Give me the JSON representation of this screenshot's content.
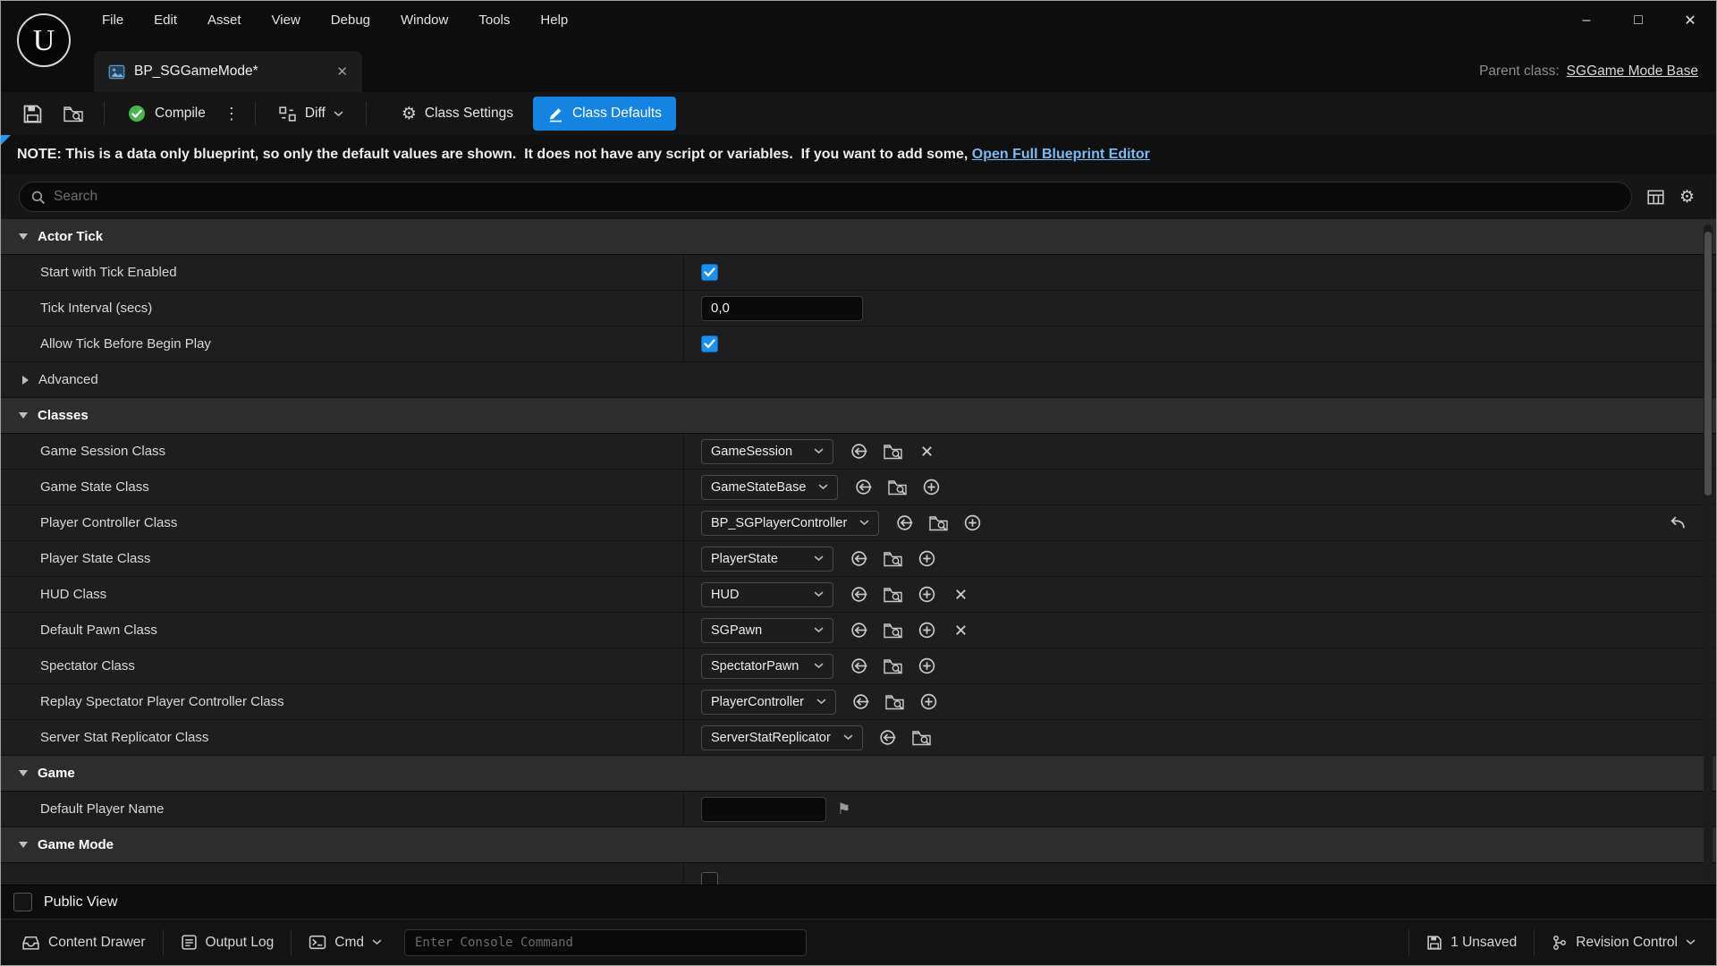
{
  "colors": {
    "accent": "#1583e0",
    "checkbox_blue": "#1f8fef",
    "link_blue": "#7cb9f7",
    "compile_green": "#46b54e"
  },
  "icons": {
    "gear": "⚙",
    "kebab": "⋮",
    "flag": "⚑"
  },
  "menu": {
    "items": [
      "File",
      "Edit",
      "Asset",
      "View",
      "Debug",
      "Window",
      "Tools",
      "Help"
    ]
  },
  "window_controls": {
    "minimize": "–",
    "maximize": "□",
    "close": "✕"
  },
  "tab": {
    "title": "BP_SGGameMode*",
    "close": "✕"
  },
  "parent_class": {
    "label": "Parent class:",
    "value": "SGGame Mode Base"
  },
  "toolbar": {
    "compile": "Compile",
    "diff": "Diff",
    "class_settings": "Class Settings",
    "class_defaults": "Class Defaults"
  },
  "note": {
    "prefix": "NOTE: This is a data only blueprint, so only the default values are shown.  It does not have any script or variables.  If you want to add some, ",
    "link": "Open Full Blueprint Editor"
  },
  "search": {
    "placeholder": "Search"
  },
  "details": {
    "sections": [
      {
        "title": "Actor Tick",
        "rows": [
          {
            "label": "Start with Tick Enabled",
            "type": "checkbox",
            "checked": true
          },
          {
            "label": "Tick Interval (secs)",
            "type": "text",
            "value": "0,0"
          },
          {
            "label": "Allow Tick Before Begin Play",
            "type": "checkbox",
            "checked": true
          },
          {
            "label": "Advanced",
            "type": "category-collapsed"
          }
        ]
      },
      {
        "title": "Classes",
        "rows": [
          {
            "label": "Game Session Class",
            "type": "class",
            "value": "GameSession",
            "icons": [
              "use-selected-icon",
              "browse-icon",
              "clear-icon"
            ]
          },
          {
            "label": "Game State Class",
            "type": "class",
            "value": "GameStateBase",
            "icons": [
              "use-selected-icon",
              "browse-icon",
              "plus-icon"
            ]
          },
          {
            "label": "Player Controller Class",
            "type": "class",
            "value": "BP_SGPlayerController",
            "icons": [
              "use-selected-icon",
              "browse-icon",
              "plus-icon"
            ],
            "revert": true
          },
          {
            "label": "Player State Class",
            "type": "class",
            "value": "PlayerState",
            "icons": [
              "use-selected-icon",
              "browse-icon",
              "plus-icon"
            ]
          },
          {
            "label": "HUD Class",
            "type": "class",
            "value": "HUD",
            "icons": [
              "use-selected-icon",
              "browse-icon",
              "plus-icon",
              "clear-icon"
            ]
          },
          {
            "label": "Default Pawn Class",
            "type": "class",
            "value": "SGPawn",
            "icons": [
              "use-selected-icon",
              "browse-icon",
              "plus-icon",
              "clear-icon"
            ]
          },
          {
            "label": "Spectator Class",
            "type": "class",
            "value": "SpectatorPawn",
            "icons": [
              "use-selected-icon",
              "browse-icon",
              "plus-icon"
            ]
          },
          {
            "label": "Replay Spectator Player Controller Class",
            "type": "class",
            "value": "PlayerController",
            "icons": [
              "use-selected-icon",
              "browse-icon",
              "plus-icon"
            ]
          },
          {
            "label": "Server Stat Replicator Class",
            "type": "class",
            "value": "ServerStatReplicator",
            "icons": [
              "use-selected-icon",
              "browse-icon"
            ]
          }
        ]
      },
      {
        "title": "Game",
        "rows": [
          {
            "label": "Default Player Name",
            "type": "text-flag",
            "value": ""
          }
        ]
      },
      {
        "title": "Game Mode",
        "rows": [
          {
            "label": "",
            "type": "checkbox",
            "checked": false
          }
        ]
      }
    ]
  },
  "footer": {
    "public_view": "Public View"
  },
  "statusbar": {
    "content_drawer": "Content Drawer",
    "output_log": "Output Log",
    "cmd": "Cmd",
    "console_placeholder": "Enter Console Command",
    "unsaved": "1 Unsaved",
    "revision_control": "Revision Control"
  }
}
